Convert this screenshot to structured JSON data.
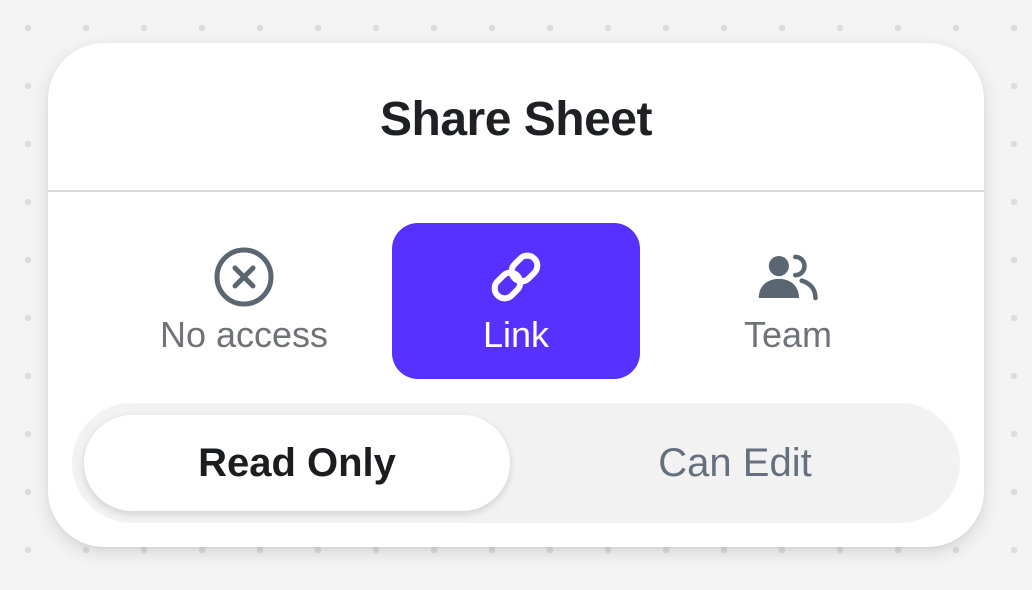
{
  "sheet": {
    "title": "Share Sheet"
  },
  "access_options": [
    {
      "label": "No access",
      "icon": "close-circle-icon",
      "selected": false
    },
    {
      "label": "Link",
      "icon": "link-icon",
      "selected": true
    },
    {
      "label": "Team",
      "icon": "team-icon",
      "selected": false
    }
  ],
  "permission": {
    "options": [
      "Read Only",
      "Can Edit"
    ],
    "selected": "Read Only"
  },
  "colors": {
    "accent": "#5631ff",
    "icon_gray": "#5b6673",
    "background": "#f4f4f5"
  }
}
